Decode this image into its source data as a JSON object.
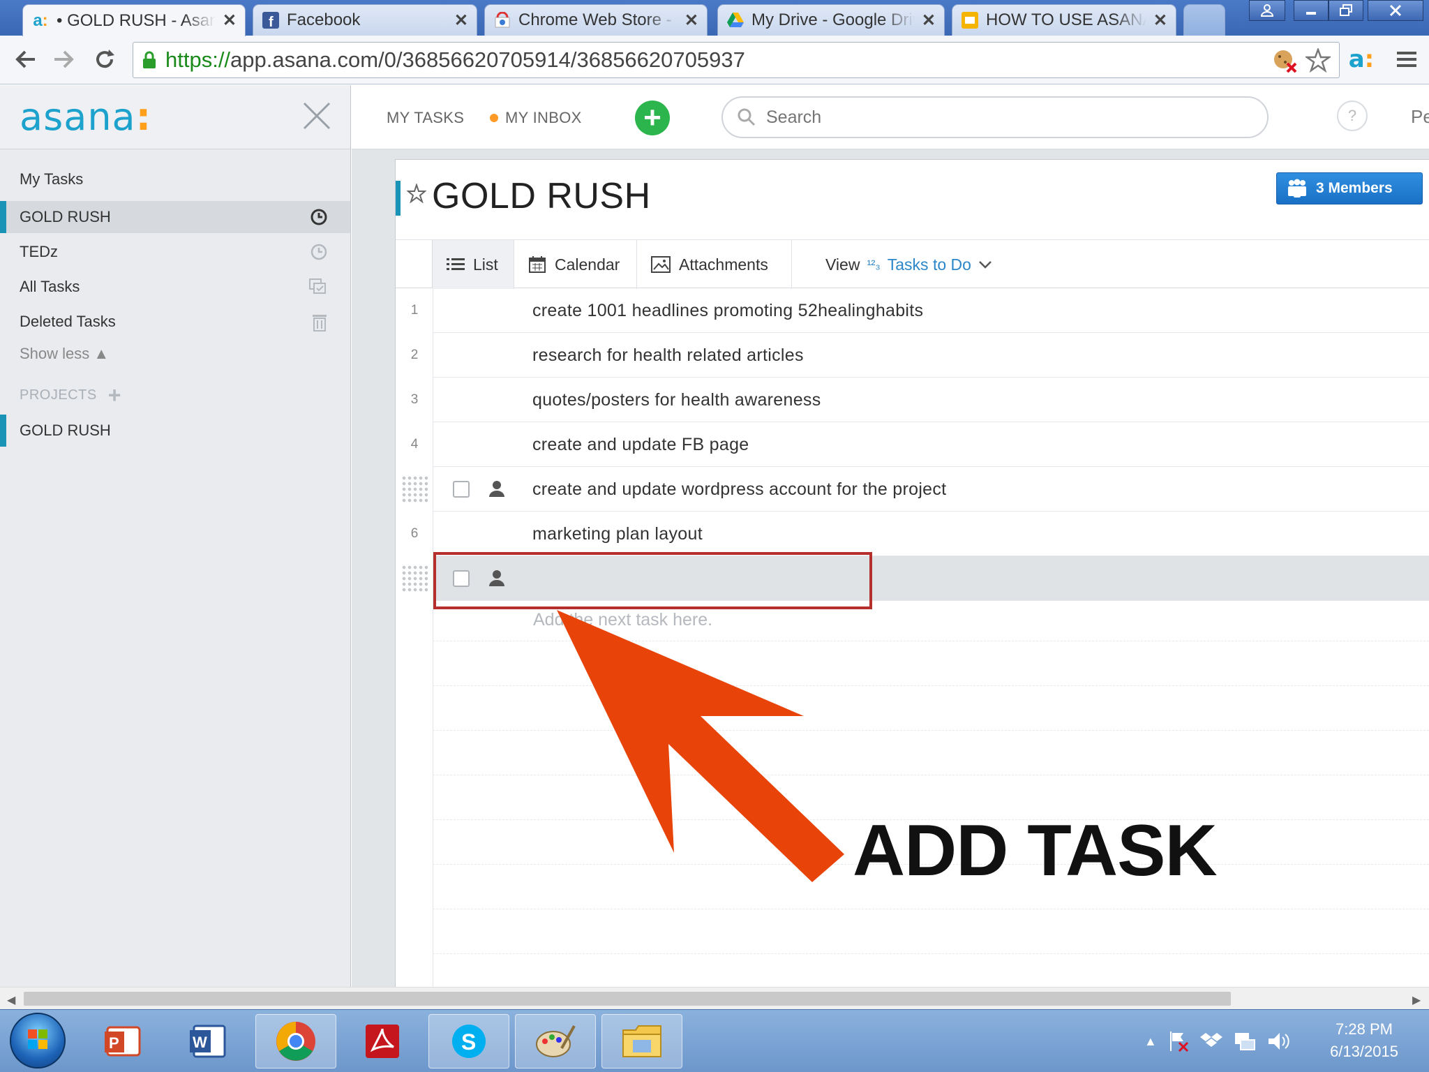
{
  "browser": {
    "tabs": [
      {
        "title": "• GOLD RUSH - Asana",
        "icon": "asana-icon",
        "active": true
      },
      {
        "title": "Facebook",
        "icon": "facebook-icon"
      },
      {
        "title": "Chrome Web Store - ",
        "icon": "chrome-web-store-icon"
      },
      {
        "title": "My Drive - Google Drive",
        "icon": "google-drive-icon"
      },
      {
        "title": "HOW TO USE ASANA",
        "icon": "slides-icon"
      }
    ],
    "url_scheme": "https://",
    "url_rest": "app.asana.com/0/36856620705914/36856620705937"
  },
  "sidebar": {
    "logo": "asana",
    "logo_dots": ":",
    "items": [
      {
        "label": "My Tasks"
      },
      {
        "label": "GOLD RUSH",
        "icon": "clock-icon",
        "selected": true
      },
      {
        "label": "TEDz",
        "icon": "clock-icon"
      },
      {
        "label": "All Tasks",
        "icon": "all-tasks-icon"
      },
      {
        "label": "Deleted Tasks",
        "icon": "trash-icon"
      }
    ],
    "show_less": "Show less ▲",
    "projects_label": "PROJECTS",
    "projects": [
      {
        "label": "GOLD RUSH"
      }
    ]
  },
  "topbar": {
    "my_tasks": "MY TASKS",
    "my_inbox": "MY INBOX",
    "add": "+",
    "search_placeholder": "Search",
    "help": "?",
    "cut_text": "Pe"
  },
  "project": {
    "title": "GOLD RUSH",
    "members": "3 Members",
    "tabs": [
      {
        "label": "List",
        "icon": "list-icon",
        "active": true
      },
      {
        "label": "Calendar",
        "icon": "calendar-icon"
      },
      {
        "label": "Attachments",
        "icon": "image-icon"
      }
    ],
    "view_label": "View",
    "view_sort_icon": "¹²₃",
    "view_value": "Tasks to Do",
    "tasks": [
      {
        "num": "1",
        "name": "create 1001 headlines promoting 52healinghabits"
      },
      {
        "num": "2",
        "name": "research for health related articles"
      },
      {
        "num": "3",
        "name": "quotes/posters for health awareness"
      },
      {
        "num": "4",
        "name": "create and update FB page"
      },
      {
        "num": "",
        "name": "create and update wordpress account for the project"
      },
      {
        "num": "6",
        "name": "marketing plan layout"
      },
      {
        "num": "",
        "name": ""
      }
    ],
    "add_next_placeholder": "Add the next task here."
  },
  "callout": {
    "text": "ADD TASK",
    "arrow_color": "#e8440a",
    "box_color": "#b5302c"
  },
  "taskbar": {
    "apps": [
      "powerpoint-icon",
      "word-icon",
      "chrome-icon",
      "acrobat-icon",
      "skype-icon",
      "paint-icon",
      "file-explorer-icon"
    ],
    "time": "7:28 PM",
    "date": "6/13/2015"
  },
  "colors": {
    "asana_teal": "#1993b6",
    "add_green": "#2bb54c",
    "inbox_orange": "#ff9a26",
    "members_blue": "#1a70c6"
  }
}
